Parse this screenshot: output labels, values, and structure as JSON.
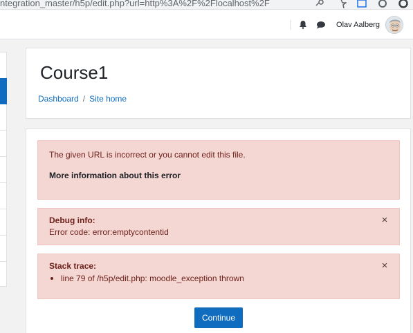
{
  "browser": {
    "url_fragment": "ntegration_master/h5p/edit.php?url=http%3A%2F%2Flocalhost%2F",
    "icons": [
      "key-icon",
      "star-icon",
      "extension-icon",
      "refresh-icon",
      "profile-icon"
    ]
  },
  "navbar": {
    "user_name": "Olav Aalberg",
    "icons": [
      "bell-icon",
      "chat-icon"
    ]
  },
  "header": {
    "title": "Course1",
    "breadcrumb": [
      {
        "label": "Dashboard"
      },
      {
        "label": "Site home"
      }
    ],
    "separator": "/"
  },
  "error": {
    "message": "The given URL is incorrect or you cannot edit this file.",
    "more_info": "More information about this error"
  },
  "debug": {
    "title": "Debug info:",
    "text": "Error code: error:emptycontentid",
    "close": "×"
  },
  "stack": {
    "title": "Stack trace:",
    "items": [
      "line 79 of /h5p/edit.php: moodle_exception thrown"
    ],
    "close": "×"
  },
  "actions": {
    "continue_label": "Continue"
  },
  "colors": {
    "primary": "#0f6cbf",
    "alert_bg": "#f4d6d2",
    "alert_text": "#6e211a"
  }
}
